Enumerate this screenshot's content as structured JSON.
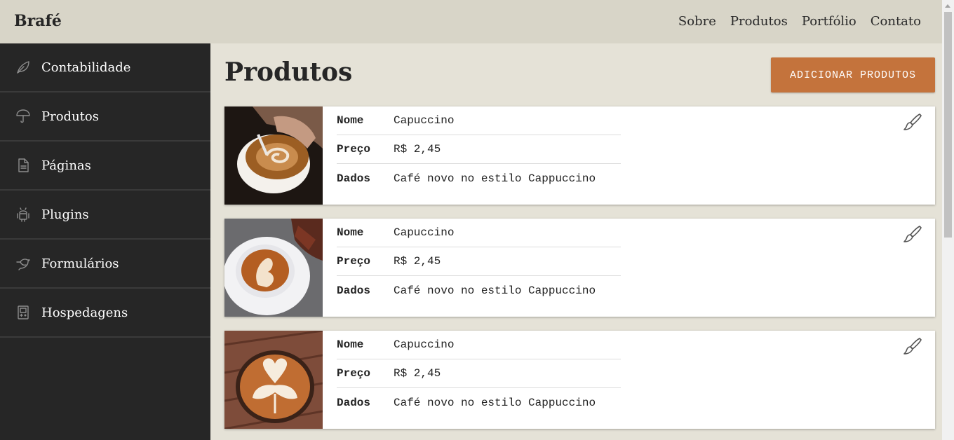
{
  "header": {
    "brand": "Brafé",
    "nav": [
      {
        "label": "Sobre"
      },
      {
        "label": "Produtos"
      },
      {
        "label": "Portfólio"
      },
      {
        "label": "Contato"
      }
    ]
  },
  "sidebar": {
    "items": [
      {
        "label": "Contabilidade",
        "icon": "leaf-icon"
      },
      {
        "label": "Produtos",
        "icon": "umbrella-icon"
      },
      {
        "label": "Páginas",
        "icon": "document-icon"
      },
      {
        "label": "Plugins",
        "icon": "android-icon"
      },
      {
        "label": "Formulários",
        "icon": "bird-icon"
      },
      {
        "label": "Hospedagens",
        "icon": "gameboy-icon"
      }
    ]
  },
  "main": {
    "title": "Produtos",
    "add_button": "ADICIONAR PRODUTOS",
    "products": [
      {
        "name_label": "Nome",
        "name": "Capuccino",
        "price_label": "Preço",
        "price": "R$ 2,45",
        "data_label": "Dados",
        "data": "Café novo no estilo Cappuccino"
      },
      {
        "name_label": "Nome",
        "name": "Capuccino",
        "price_label": "Preço",
        "price": "R$ 2,45",
        "data_label": "Dados",
        "data": "Café novo no estilo Cappuccino"
      },
      {
        "name_label": "Nome",
        "name": "Capuccino",
        "price_label": "Preço",
        "price": "R$ 2,45",
        "data_label": "Dados",
        "data": "Café novo no estilo Cappuccino"
      }
    ]
  },
  "colors": {
    "header_bg": "#d8d5c8",
    "sidebar_bg": "#262626",
    "page_bg": "#e5e2d7",
    "accent": "#c4733c"
  }
}
